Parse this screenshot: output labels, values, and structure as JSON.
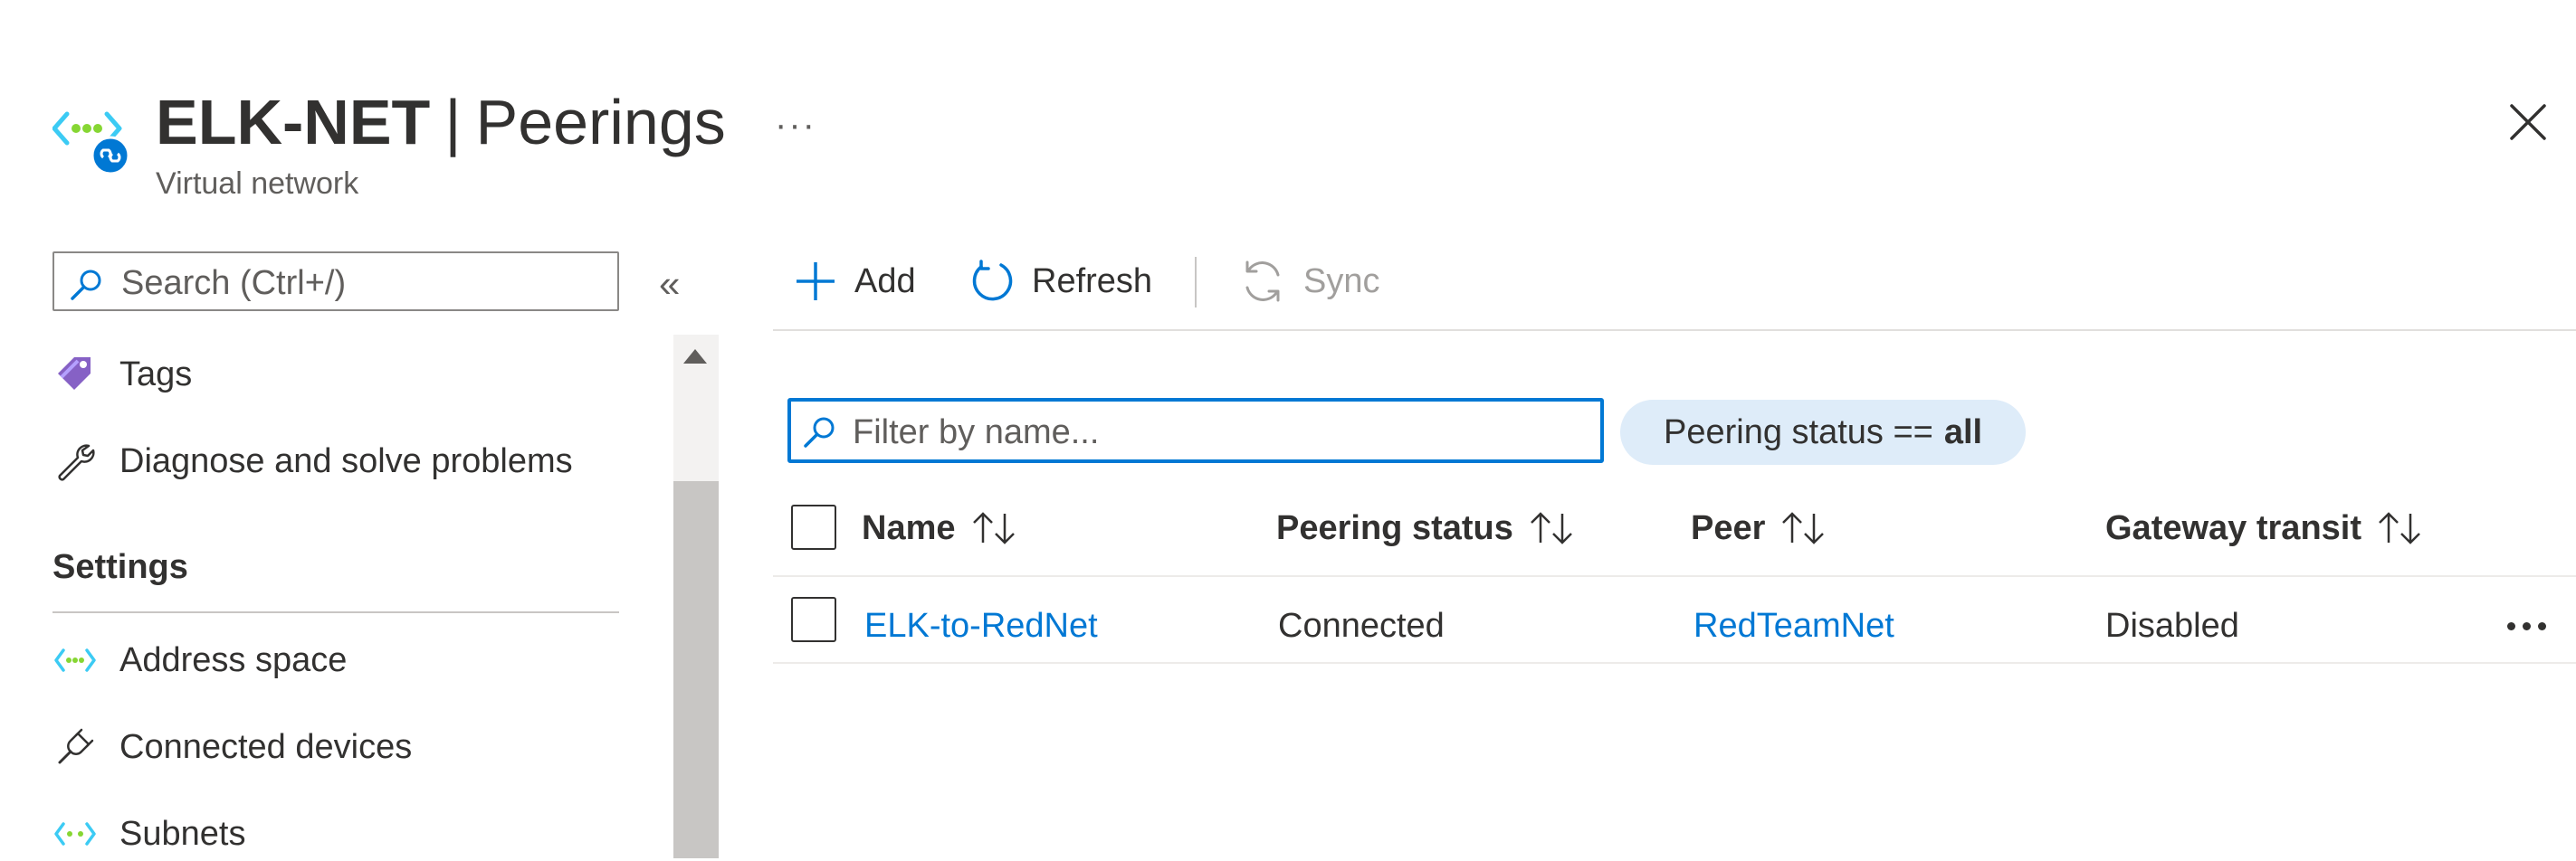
{
  "header": {
    "resource_name": "ELK-NET",
    "separator": "|",
    "blade_title": "Peerings",
    "subtitle": "Virtual network",
    "more_label": "···",
    "resource_icon": "virtual-network-icon",
    "close_icon": "close-icon"
  },
  "sidebar": {
    "search_placeholder": "Search (Ctrl+/)",
    "collapse_label": "«",
    "items_top": [
      {
        "label": "Tags",
        "icon": "tag-icon"
      },
      {
        "label": "Diagnose and solve problems",
        "icon": "wrench-icon"
      }
    ],
    "section_title": "Settings",
    "items_settings": [
      {
        "label": "Address space",
        "icon": "address-space-icon"
      },
      {
        "label": "Connected devices",
        "icon": "plug-icon"
      },
      {
        "label": "Subnets",
        "icon": "subnets-icon"
      }
    ]
  },
  "toolbar": {
    "add_label": "Add",
    "refresh_label": "Refresh",
    "sync_label": "Sync"
  },
  "filter": {
    "placeholder": "Filter by name...",
    "value": "",
    "pill_label": "Peering status ==",
    "pill_value": "all"
  },
  "table": {
    "columns": [
      "Name",
      "Peering status",
      "Peer",
      "Gateway transit"
    ],
    "rows": [
      {
        "name": "ELK-to-RedNet",
        "peering_status": "Connected",
        "peer": "RedTeamNet",
        "gateway_transit": "Disabled"
      }
    ]
  },
  "colors": {
    "accent": "#0078d4",
    "text": "#323130",
    "muted": "#605e5c",
    "pill_bg": "#deecf9",
    "disabled": "#a19f9d"
  }
}
